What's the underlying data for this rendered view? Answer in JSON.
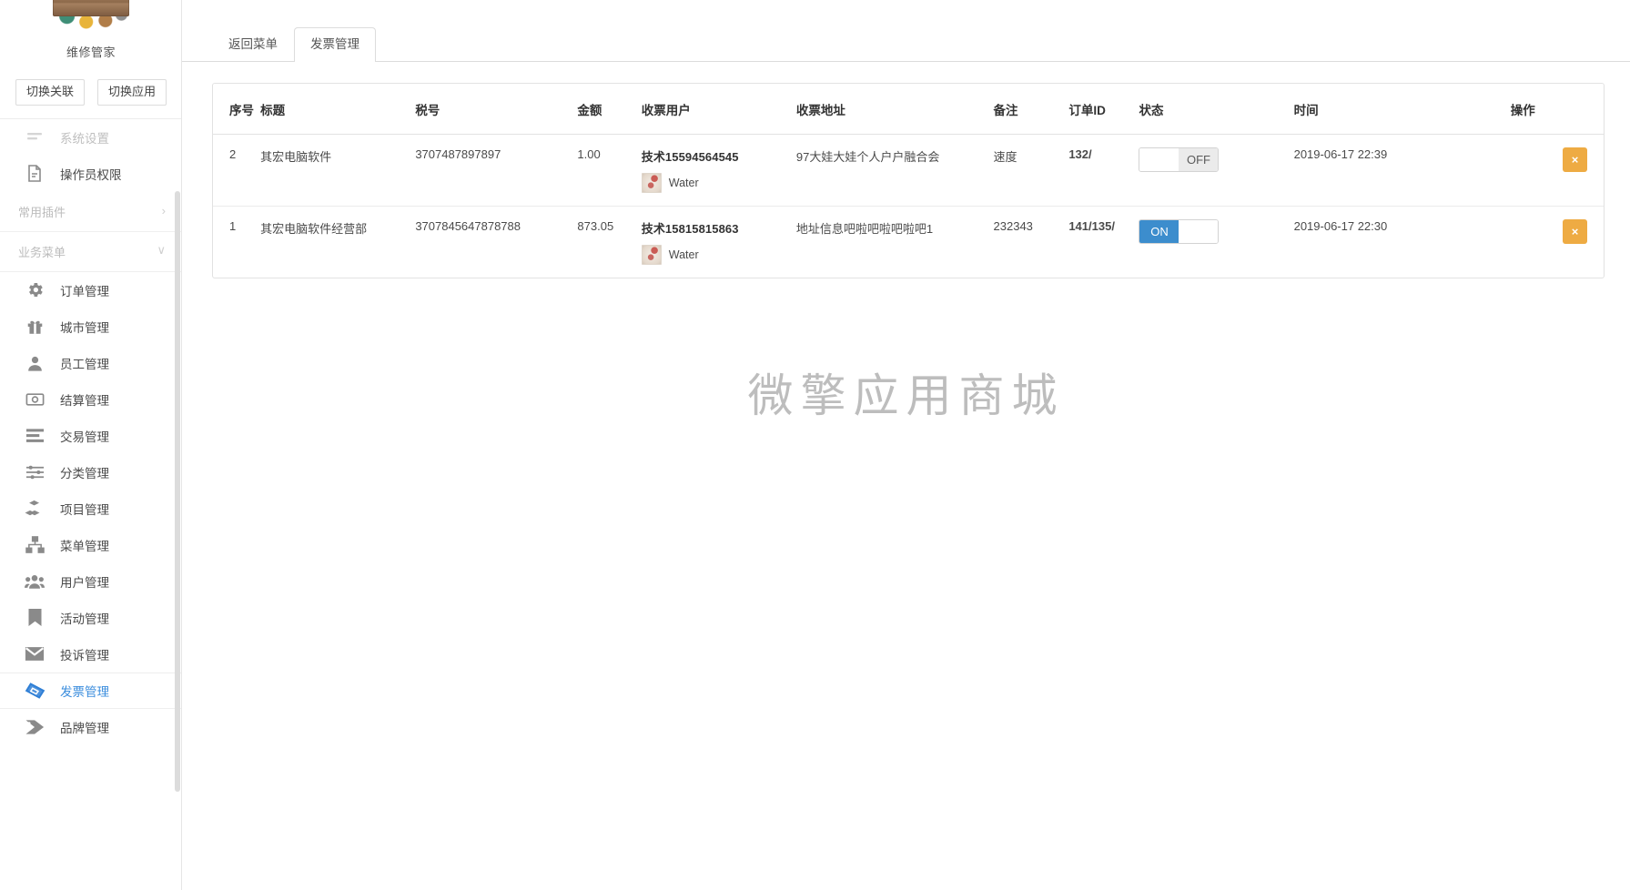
{
  "sidebar": {
    "brand_name": "维修管家",
    "switch_buttons": [
      {
        "label": "切换关联",
        "name": "switch-association-button"
      },
      {
        "label": "切换应用",
        "name": "switch-app-button"
      }
    ],
    "clipped_item_label": "系统设置",
    "top_items": [
      {
        "label": "操作员权限",
        "icon": "document-edit-icon"
      }
    ],
    "groups": [
      {
        "label": "常用插件",
        "chevron": "›"
      },
      {
        "label": "业务菜单",
        "chevron": "∨"
      }
    ],
    "items": [
      {
        "label": "订单管理",
        "icon": "gear-icon"
      },
      {
        "label": "城市管理",
        "icon": "gift-icon"
      },
      {
        "label": "员工管理",
        "icon": "person-icon"
      },
      {
        "label": "结算管理",
        "icon": "banknote-icon"
      },
      {
        "label": "交易管理",
        "icon": "list-lines-icon"
      },
      {
        "label": "分类管理",
        "icon": "sliders-icon"
      },
      {
        "label": "项目管理",
        "icon": "boxes-icon"
      },
      {
        "label": "菜单管理",
        "icon": "sitemap-icon"
      },
      {
        "label": "用户管理",
        "icon": "users-icon"
      },
      {
        "label": "活动管理",
        "icon": "bookmark-icon"
      },
      {
        "label": "投诉管理",
        "icon": "envelope-icon"
      },
      {
        "label": "发票管理",
        "icon": "ticket-icon",
        "active": true
      },
      {
        "label": "品牌管理",
        "icon": "tag-icon"
      }
    ],
    "accent_color": "#3b8ddd"
  },
  "tabs": [
    {
      "label": "返回菜单",
      "active": false
    },
    {
      "label": "发票管理",
      "active": true
    }
  ],
  "watermark": "微擎应用商城",
  "table": {
    "columns": [
      "序号",
      "标题",
      "税号",
      "金额",
      "收票用户",
      "收票地址",
      "备注",
      "订单ID",
      "状态",
      "时间",
      "操作"
    ],
    "rows": [
      {
        "index": "2",
        "title": "其宏电脑软件",
        "tax_no": "3707487897897",
        "amount": "1.00",
        "user_name": "技术15594564545",
        "user_nickname": "Water",
        "address": "97大娃大娃个人户户融合会",
        "note": "速度",
        "order_id": "132/",
        "state": "OFF",
        "state_on": false,
        "time": "2019-06-17 22:39",
        "delete_label": "×"
      },
      {
        "index": "1",
        "title": "其宏电脑软件经营部",
        "tax_no": "3707845647878788",
        "amount": "873.05",
        "user_name": "技术15815815863",
        "user_nickname": "Water",
        "address": "地址信息吧啦吧啦吧啦吧1",
        "note": "232343",
        "order_id": "141/135/",
        "state": "ON",
        "state_on": true,
        "time": "2019-06-17 22:30",
        "delete_label": "×"
      }
    ]
  },
  "colors": {
    "toggle_on": "#3c8dcd",
    "delete_button": "#eeab43",
    "watermark": "#bdbdbd"
  }
}
